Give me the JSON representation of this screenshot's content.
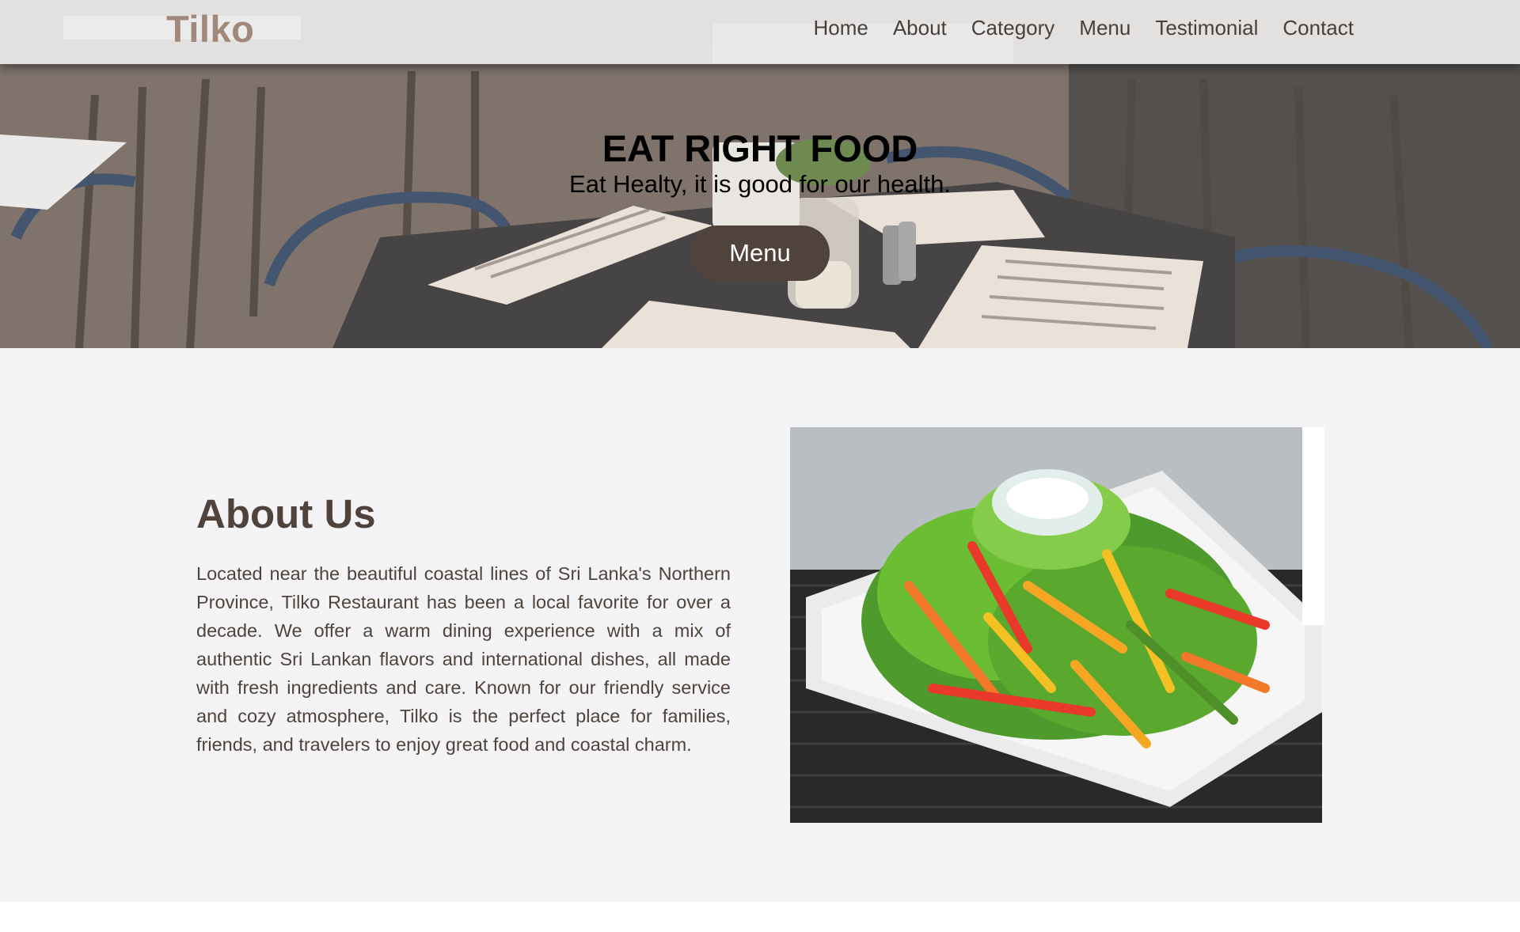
{
  "navbar": {
    "brand": "Tilko",
    "links": [
      "Home",
      "About",
      "Category",
      "Menu",
      "Testimonial",
      "Contact"
    ]
  },
  "hero": {
    "title": "EAT RIGHT FOOD",
    "subtitle": "Eat Healty, it is good for our health.",
    "button_label": "Menu",
    "background_image": "restaurant-interior-photo"
  },
  "about": {
    "heading": "About Us",
    "paragraph": "Located near the beautiful coastal lines of Sri Lanka's Northern Province, Tilko Restaurant has been a local favorite for over a decade. We offer a warm dining experience with a mix of authentic Sri Lankan flavors and international dishes, all made with fresh ingredients and care. Known for our friendly service and cozy atmosphere, Tilko is the perfect place for families, friends, and travelers to enjoy great food and coastal charm.",
    "image": "salad-plate-photo"
  },
  "colors": {
    "brand": "#a1887a",
    "button": "#4f433b",
    "heading": "#4f433b",
    "section_bg": "#f4f4f6"
  }
}
